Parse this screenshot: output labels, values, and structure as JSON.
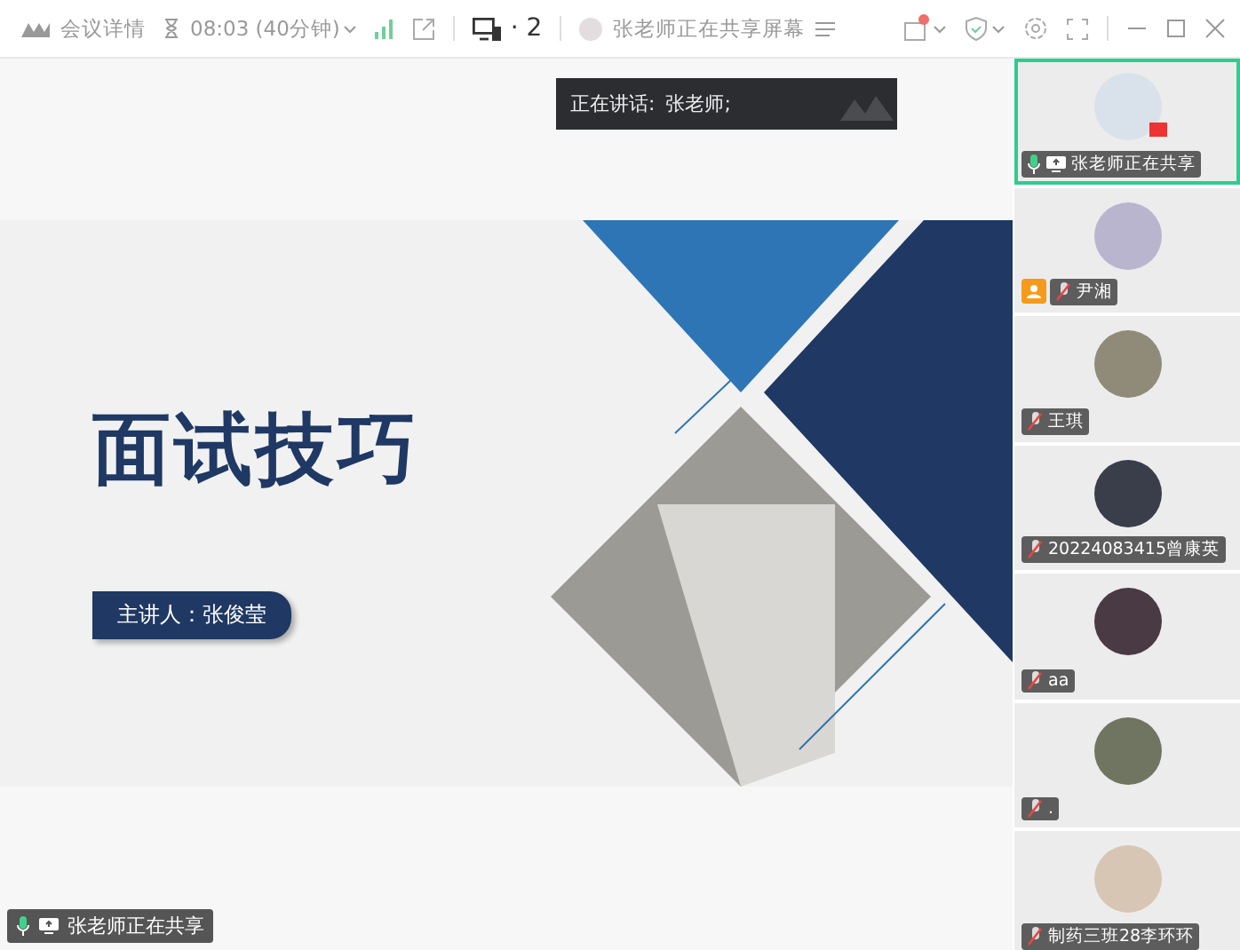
{
  "toolbar": {
    "meeting_info": "会议详情",
    "timer": "08:03 (40分钟)",
    "device_count": "· 2",
    "sharing_status": "张老师正在共享屏幕",
    "notification_dot": true
  },
  "speaking": {
    "label": "正在讲话:",
    "name": "张老师;"
  },
  "slide": {
    "title": "面试技巧",
    "presenter": "主讲人：张俊莹"
  },
  "share_badge": {
    "text": "张老师正在共享",
    "mic_on": true
  },
  "participants": [
    {
      "name": "张老师正在共享",
      "selected": true,
      "mic_on": true,
      "sharing": true,
      "host": false
    },
    {
      "name": "尹湘",
      "selected": false,
      "mic_on": false,
      "sharing": false,
      "host": true
    },
    {
      "name": "王琪",
      "selected": false,
      "mic_on": false,
      "sharing": false,
      "host": false
    },
    {
      "name": "20224083415曾康英",
      "selected": false,
      "mic_on": false,
      "sharing": false,
      "host": false
    },
    {
      "name": "aa",
      "selected": false,
      "mic_on": false,
      "sharing": false,
      "host": false
    },
    {
      "name": ".",
      "selected": false,
      "mic_on": false,
      "sharing": false,
      "host": false
    },
    {
      "name": "制药三班28李环环",
      "selected": false,
      "mic_on": false,
      "sharing": false,
      "host": false
    }
  ]
}
